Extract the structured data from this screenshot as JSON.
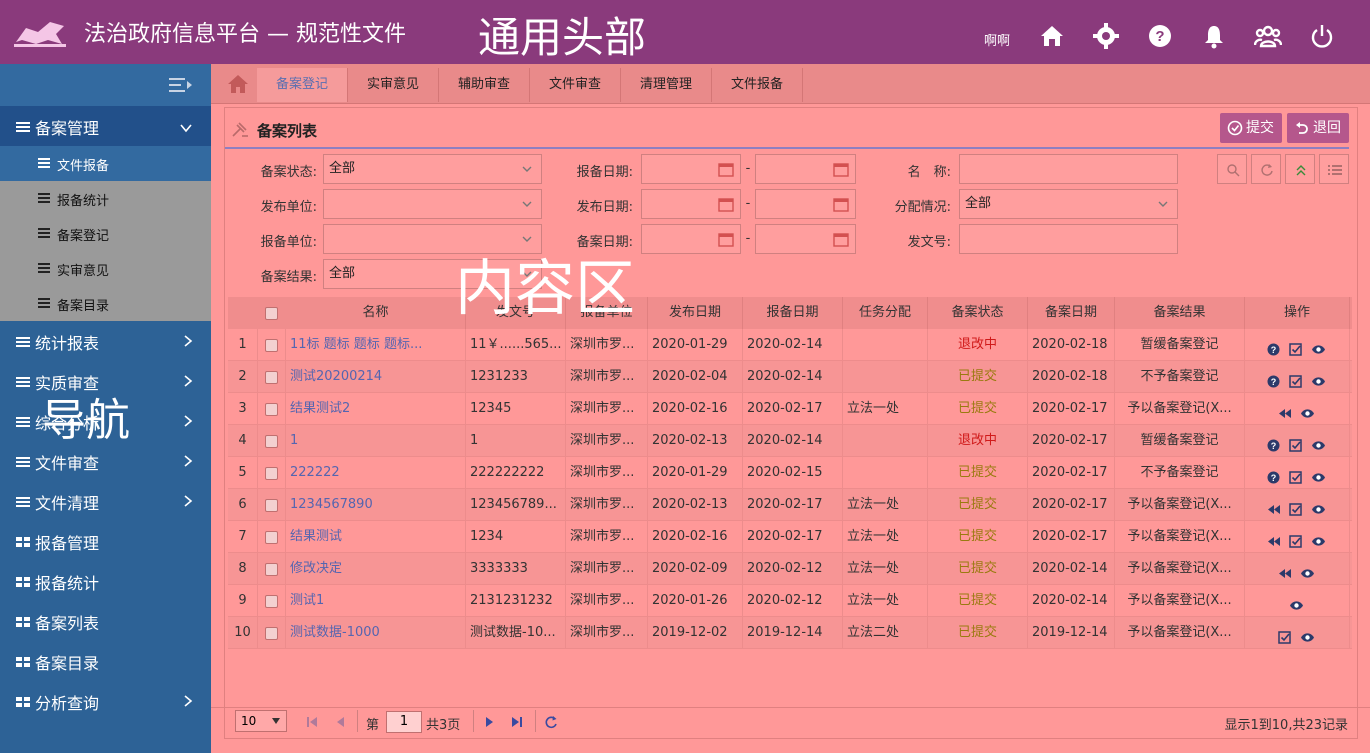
{
  "header": {
    "app_title": "法治政府信息平台 — 规范性文件",
    "overlay_label": "通用头部",
    "username": "啊啊",
    "icons": [
      "home-icon",
      "gear-icon",
      "help-icon",
      "bell-icon",
      "users-icon",
      "power-icon"
    ],
    "bg_color": "#8a3a7c"
  },
  "sidebar": {
    "overlay_label": "导航",
    "groups": [
      {
        "label": "备案管理",
        "icon": "list-icon",
        "chevron": "down",
        "expanded": true,
        "children": [
          {
            "label": "文件报备",
            "active": true
          },
          {
            "label": "报备统计"
          },
          {
            "label": "备案登记"
          },
          {
            "label": "实审意见"
          },
          {
            "label": "备案目录"
          }
        ]
      },
      {
        "label": "统计报表",
        "icon": "list-icon",
        "chevron": "right"
      },
      {
        "label": "实质审查",
        "icon": "list-icon",
        "chevron": "right"
      },
      {
        "label": "综合分析",
        "icon": "list-icon",
        "chevron": "right"
      },
      {
        "label": "文件审查",
        "icon": "list-icon",
        "chevron": "right"
      },
      {
        "label": "文件清理",
        "icon": "list-icon",
        "chevron": "right"
      },
      {
        "label": "报备管理",
        "icon": "grid-icon",
        "chevron": ""
      },
      {
        "label": "报备统计",
        "icon": "grid-icon",
        "chevron": ""
      },
      {
        "label": "备案列表",
        "icon": "grid-icon",
        "chevron": ""
      },
      {
        "label": "备案目录",
        "icon": "grid-icon",
        "chevron": ""
      },
      {
        "label": "分析查询",
        "icon": "grid-icon",
        "chevron": "right"
      }
    ]
  },
  "tabs": [
    {
      "label": "备案登记",
      "active": true
    },
    {
      "label": "实审意见"
    },
    {
      "label": "辅助审查"
    },
    {
      "label": "文件审查"
    },
    {
      "label": "清理管理"
    },
    {
      "label": "文件报备"
    }
  ],
  "panel": {
    "title": "备案列表",
    "submit_label": "提交",
    "back_label": "退回",
    "overlay_label": "内容区"
  },
  "filters": {
    "status_label": "备案状态:",
    "status_value": "全部",
    "report_date_label": "报备日期:",
    "name_label": "名　称:",
    "publisher_label": "发布单位:",
    "publisher_value": "",
    "publish_date_label": "发布日期:",
    "assign_label": "分配情况:",
    "assign_value": "全部",
    "report_unit_label": "报备单位:",
    "report_unit_value": "",
    "record_date_label": "备案日期:",
    "doc_no_label": "发文号:",
    "result_label": "备案结果:",
    "result_value": "全部",
    "date_sep": "-"
  },
  "table": {
    "columns": [
      "名称",
      "发文号",
      "报备单位",
      "发布日期",
      "报备日期",
      "任务分配",
      "备案状态",
      "备案日期",
      "备案结果",
      "操作"
    ],
    "rows": [
      {
        "n": "1",
        "name": "11标 题标 题标 题标...",
        "no": "11￥......565...",
        "unit": "深圳市罗...",
        "pub": "2020-01-29",
        "rep": "2020-02-14",
        "task": "",
        "status": "退改中",
        "st": "red",
        "rec": "2020-02-18",
        "result": "暂缓备案登记",
        "acts": [
          "help",
          "check",
          "eye"
        ]
      },
      {
        "n": "2",
        "name": "测试20200214",
        "no": "1231233",
        "unit": "深圳市罗...",
        "pub": "2020-02-04",
        "rep": "2020-02-14",
        "task": "",
        "status": "已提交",
        "st": "yel",
        "rec": "2020-02-18",
        "result": "不予备案登记",
        "acts": [
          "help",
          "check",
          "eye"
        ]
      },
      {
        "n": "3",
        "name": "结果测试2",
        "no": "12345",
        "unit": "深圳市罗...",
        "pub": "2020-02-16",
        "rep": "2020-02-17",
        "task": "立法一处",
        "status": "已提交",
        "st": "yel",
        "rec": "2020-02-17",
        "result": "予以备案登记(X...",
        "acts": [
          "back",
          "eye"
        ]
      },
      {
        "n": "4",
        "name": "1",
        "no": "1",
        "unit": "深圳市罗...",
        "pub": "2020-02-13",
        "rep": "2020-02-14",
        "task": "",
        "status": "退改中",
        "st": "red",
        "rec": "2020-02-17",
        "result": "暂缓备案登记",
        "acts": [
          "help",
          "check",
          "eye"
        ]
      },
      {
        "n": "5",
        "name": "222222",
        "no": "222222222",
        "unit": "深圳市罗...",
        "pub": "2020-01-29",
        "rep": "2020-02-15",
        "task": "",
        "status": "已提交",
        "st": "yel",
        "rec": "2020-02-17",
        "result": "不予备案登记",
        "acts": [
          "help",
          "check",
          "eye"
        ]
      },
      {
        "n": "6",
        "name": "1234567890",
        "no": "123456789...",
        "unit": "深圳市罗...",
        "pub": "2020-02-13",
        "rep": "2020-02-17",
        "task": "立法一处",
        "status": "已提交",
        "st": "yel",
        "rec": "2020-02-17",
        "result": "予以备案登记(X...",
        "acts": [
          "back",
          "check",
          "eye"
        ]
      },
      {
        "n": "7",
        "name": "结果测试",
        "no": "1234",
        "unit": "深圳市罗...",
        "pub": "2020-02-16",
        "rep": "2020-02-17",
        "task": "立法一处",
        "status": "已提交",
        "st": "yel",
        "rec": "2020-02-17",
        "result": "予以备案登记(X...",
        "acts": [
          "back",
          "check",
          "eye"
        ]
      },
      {
        "n": "8",
        "name": "修改决定",
        "no": "3333333",
        "unit": "深圳市罗...",
        "pub": "2020-02-09",
        "rep": "2020-02-12",
        "task": "立法一处",
        "status": "已提交",
        "st": "yel",
        "rec": "2020-02-14",
        "result": "予以备案登记(X...",
        "acts": [
          "back",
          "eye"
        ]
      },
      {
        "n": "9",
        "name": "测试1",
        "no": "2131231232",
        "unit": "深圳市罗...",
        "pub": "2020-01-26",
        "rep": "2020-02-12",
        "task": "立法一处",
        "status": "已提交",
        "st": "yel",
        "rec": "2020-02-14",
        "result": "予以备案登记(X...",
        "acts": [
          "eye"
        ]
      },
      {
        "n": "10",
        "name": "测试数据-1000",
        "no": "测试数据-10...",
        "unit": "深圳市罗...",
        "pub": "2019-12-02",
        "rep": "2019-12-14",
        "task": "立法二处",
        "status": "已提交",
        "st": "yel",
        "rec": "2019-12-14",
        "result": "予以备案登记(X...",
        "acts": [
          "check",
          "eye"
        ]
      }
    ]
  },
  "pager": {
    "page_size": "10",
    "page_prefix": "第",
    "page_num": "1",
    "page_suffix": "共3页",
    "summary": "显示1到10,共23记录"
  }
}
